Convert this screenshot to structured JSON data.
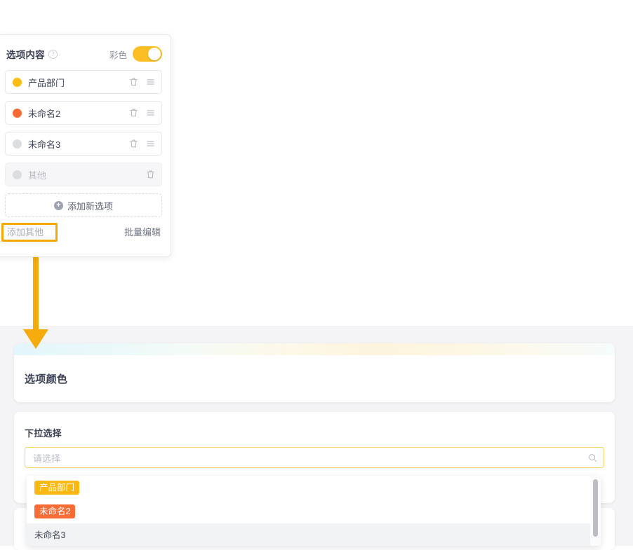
{
  "editor_panel": {
    "title": "选项内容",
    "help_icon": "question-circle-icon",
    "color_toggle_label": "彩色",
    "color_toggle_on": true,
    "options": [
      {
        "label": "产品部门",
        "color": "#febd11",
        "disabled": false,
        "delete_icon": "trash-icon",
        "drag_icon": "drag-handle-icon"
      },
      {
        "label": "未命名2",
        "color": "#fa6a34",
        "disabled": false,
        "delete_icon": "trash-icon",
        "drag_icon": "drag-handle-icon"
      },
      {
        "label": "未命名3",
        "color": "#dcdde1",
        "disabled": false,
        "delete_icon": "trash-icon",
        "drag_icon": "drag-handle-icon"
      },
      {
        "label": "其他",
        "color": "#dcdde1",
        "disabled": true,
        "delete_icon": "trash-icon",
        "drag_icon": ""
      }
    ],
    "add_new_label": "添加新选项",
    "add_new_icon": "plus-circle-icon",
    "add_other_label": "添加其他",
    "bulk_edit_label": "批量编辑",
    "highlight_color": "#f5a800"
  },
  "annotation": {
    "arrow_color": "#f5ab0c",
    "arrow_icon": "down-arrow-icon"
  },
  "preview": {
    "card_title": "选项颜色",
    "gradient_colors": [
      "#e3f6fb",
      "#fdf4dd",
      "#f5fbfc"
    ],
    "field_label": "下拉选择",
    "select_placeholder": "请选择",
    "select_value": "",
    "search_icon": "search-icon",
    "dropdown_options": [
      {
        "label": "产品部门",
        "bg": "#fcb812",
        "text": "#ffffff",
        "active": false,
        "styled": true
      },
      {
        "label": "未命名2",
        "bg": "#f96c35",
        "text": "#ffffff",
        "active": false,
        "styled": true
      },
      {
        "label": "未命名3",
        "bg": "transparent",
        "text": "#3f4454",
        "active": true,
        "styled": false
      }
    ],
    "scrollbar": "vertical-scrollbar"
  }
}
